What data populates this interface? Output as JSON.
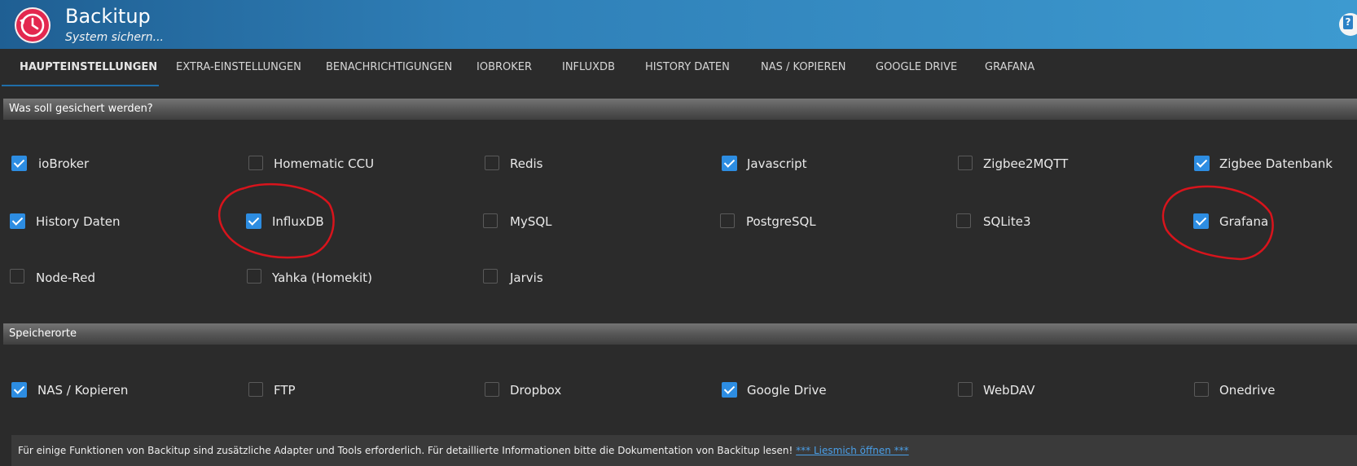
{
  "app": {
    "title": "Backitup",
    "subtitle": "System sichern...",
    "accent": "#2f7fb7",
    "icon": "clock-icon",
    "help_icon": "help-icon"
  },
  "tabs": [
    {
      "label": "HAUPTEINSTELLUNGEN",
      "active": true
    },
    {
      "label": "EXTRA-EINSTELLUNGEN"
    },
    {
      "label": "BENACHRICHTIGUNGEN"
    },
    {
      "label": "IOBROKER"
    },
    {
      "label": "INFLUXDB"
    },
    {
      "label": "HISTORY DATEN"
    },
    {
      "label": "NAS / KOPIEREN"
    },
    {
      "label": "GOOGLE DRIVE"
    },
    {
      "label": "GRAFANA"
    }
  ],
  "sections": {
    "backup": {
      "title": "Was soll gesichert werden?",
      "options": [
        {
          "label": "ioBroker",
          "checked": true
        },
        {
          "label": "Homematic CCU",
          "checked": false
        },
        {
          "label": "Redis",
          "checked": false
        },
        {
          "label": "Javascript",
          "checked": true
        },
        {
          "label": "Zigbee2MQTT",
          "checked": false
        },
        {
          "label": "Zigbee Datenbank",
          "checked": true
        },
        {
          "label": "History Daten",
          "checked": true
        },
        {
          "label": "InfluxDB",
          "checked": true
        },
        {
          "label": "MySQL",
          "checked": false
        },
        {
          "label": "PostgreSQL",
          "checked": false
        },
        {
          "label": "SQLite3",
          "checked": false
        },
        {
          "label": "Grafana",
          "checked": true
        },
        {
          "label": "Node-Red",
          "checked": false
        },
        {
          "label": "Yahka (Homekit)",
          "checked": false
        },
        {
          "label": "Jarvis",
          "checked": false
        }
      ]
    },
    "storage": {
      "title": "Speicherorte",
      "options": [
        {
          "label": "NAS / Kopieren",
          "checked": true
        },
        {
          "label": "FTP",
          "checked": false
        },
        {
          "label": "Dropbox",
          "checked": false
        },
        {
          "label": "Google Drive",
          "checked": true
        },
        {
          "label": "WebDAV",
          "checked": false
        },
        {
          "label": "Onedrive",
          "checked": false
        }
      ]
    }
  },
  "info": {
    "text": "Für einige Funktionen von Backitup sind zusätzliche Adapter und Tools erforderlich. Für detaillierte Informationen bitte die Dokumentation von Backitup lesen! ",
    "link": "*** Liesmich öffnen ***"
  }
}
